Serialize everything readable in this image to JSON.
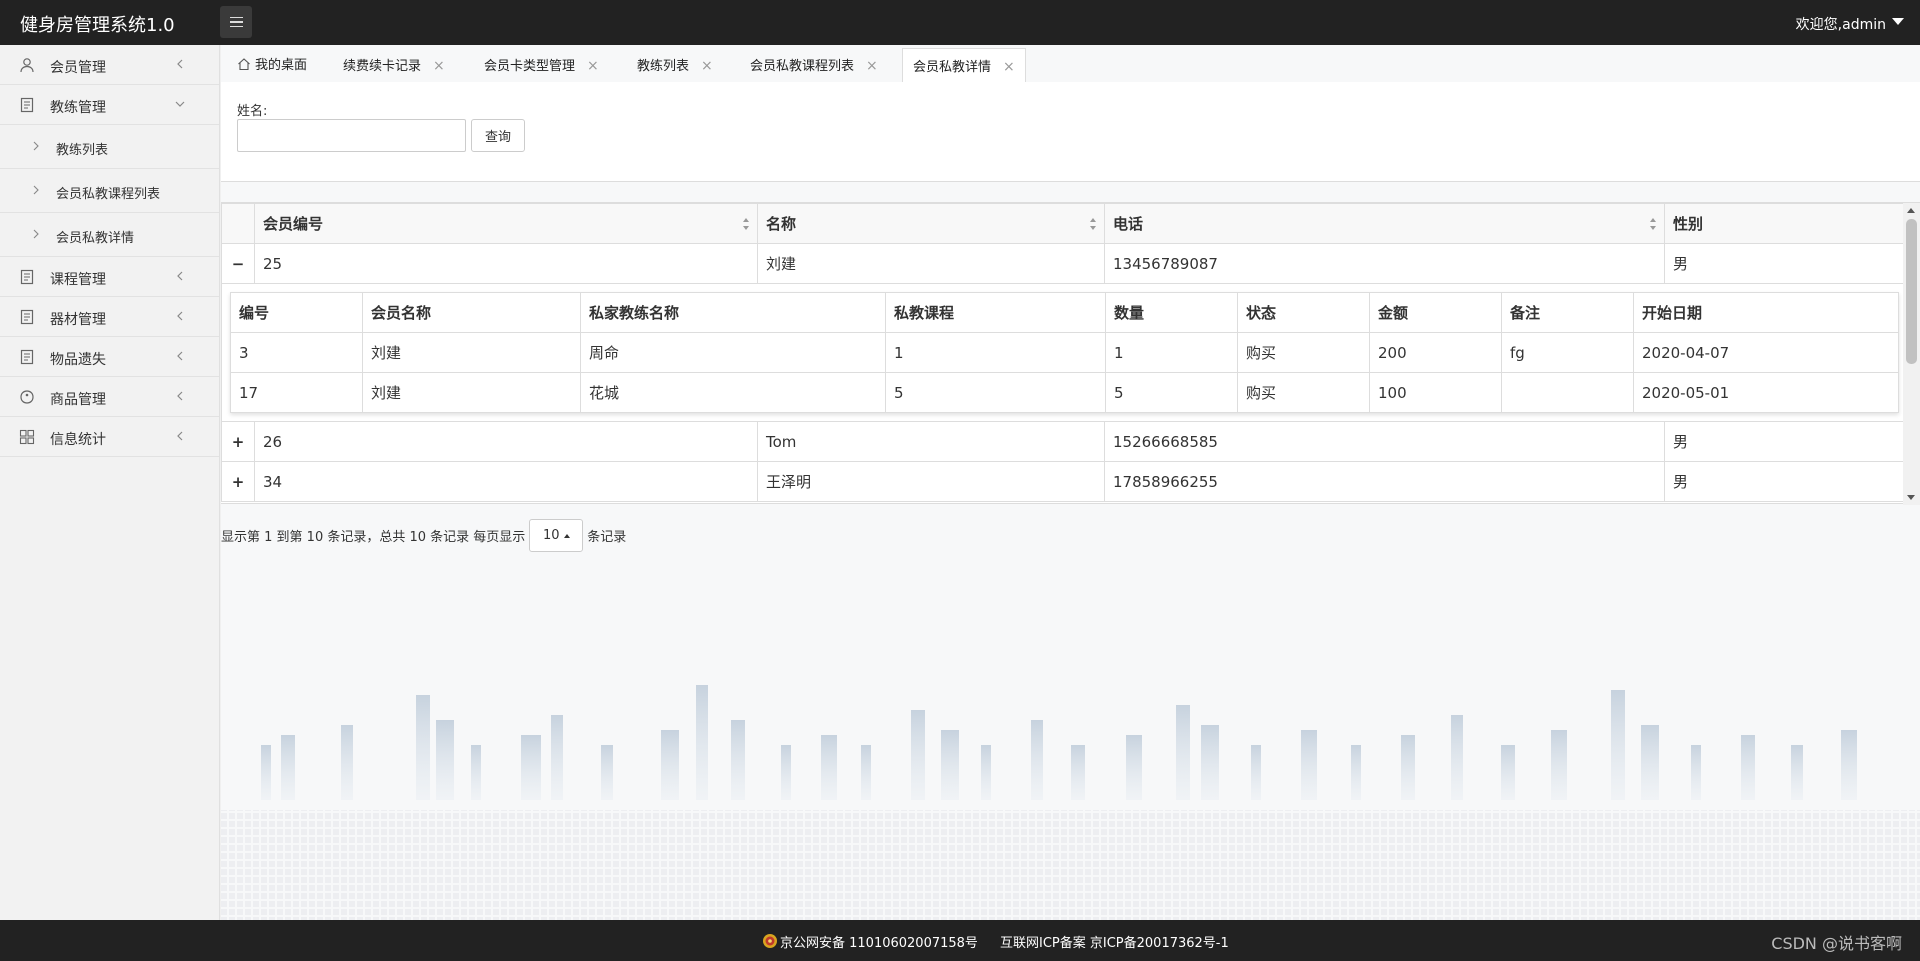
{
  "header": {
    "app_title": "健身房管理系统1.0",
    "welcome": "欢迎您,admin"
  },
  "sidebar": {
    "items": [
      {
        "label": "会员管理",
        "icon": "user-icon",
        "expanded": false
      },
      {
        "label": "教练管理",
        "icon": "document-icon",
        "expanded": true,
        "children": [
          {
            "label": "教练列表"
          },
          {
            "label": "会员私教课程列表"
          },
          {
            "label": "会员私教详情"
          }
        ]
      },
      {
        "label": "课程管理",
        "icon": "document-icon",
        "expanded": false
      },
      {
        "label": "器材管理",
        "icon": "document-icon",
        "expanded": false
      },
      {
        "label": "物品遗失",
        "icon": "document-icon",
        "expanded": false
      },
      {
        "label": "商品管理",
        "icon": "tag-icon",
        "expanded": false
      },
      {
        "label": "信息统计",
        "icon": "grid-icon",
        "expanded": false
      }
    ]
  },
  "tabs": [
    {
      "label": "我的桌面",
      "active": false,
      "closable": false
    },
    {
      "label": "续费续卡记录",
      "active": false,
      "closable": true
    },
    {
      "label": "会员卡类型管理",
      "active": false,
      "closable": true
    },
    {
      "label": "教练列表",
      "active": false,
      "closable": true
    },
    {
      "label": "会员私教课程列表",
      "active": false,
      "closable": true
    },
    {
      "label": "会员私教详情",
      "active": true,
      "closable": true
    }
  ],
  "tab_close_glyph": "×",
  "search": {
    "label": "姓名:",
    "value": "",
    "placeholder": "",
    "button": "查询"
  },
  "main_table": {
    "headers": [
      "会员编号",
      "名称",
      "电话",
      "性别"
    ],
    "rows": [
      {
        "expander": "−",
        "id": "25",
        "name": "刘建",
        "phone": "13456789087",
        "gender": "男"
      },
      {
        "expander": "+",
        "id": "26",
        "name": "Tom",
        "phone": "15266668585",
        "gender": "男"
      },
      {
        "expander": "+",
        "id": "34",
        "name": "王泽明",
        "phone": "17858966255",
        "gender": "男"
      }
    ]
  },
  "detail_table": {
    "headers": [
      "编号",
      "会员名称",
      "私家教练名称",
      "私教课程",
      "数量",
      "状态",
      "金额",
      "备注",
      "开始日期"
    ],
    "rows": [
      [
        "3",
        "刘建",
        "周命",
        "1",
        "1",
        "购买",
        "200",
        "fg",
        "2020-04-07"
      ],
      [
        "17",
        "刘建",
        "花城",
        "5",
        "5",
        "购买",
        "100",
        "",
        "2020-05-01"
      ]
    ]
  },
  "pagination": {
    "summary": "显示第 1 到第 10 条记录，总共 10 条记录 每页显示",
    "page_size": "10",
    "suffix": "条记录"
  },
  "footer": {
    "police": "京公网安备 11010602007158号",
    "icp": "互联网ICP备案 京ICP备20017362号-1",
    "watermark": "CSDN @说书客啊"
  },
  "colors": {
    "header_bg": "#222222",
    "expander": "#2262b4",
    "sidebar_bg": "#f2f2f2"
  }
}
